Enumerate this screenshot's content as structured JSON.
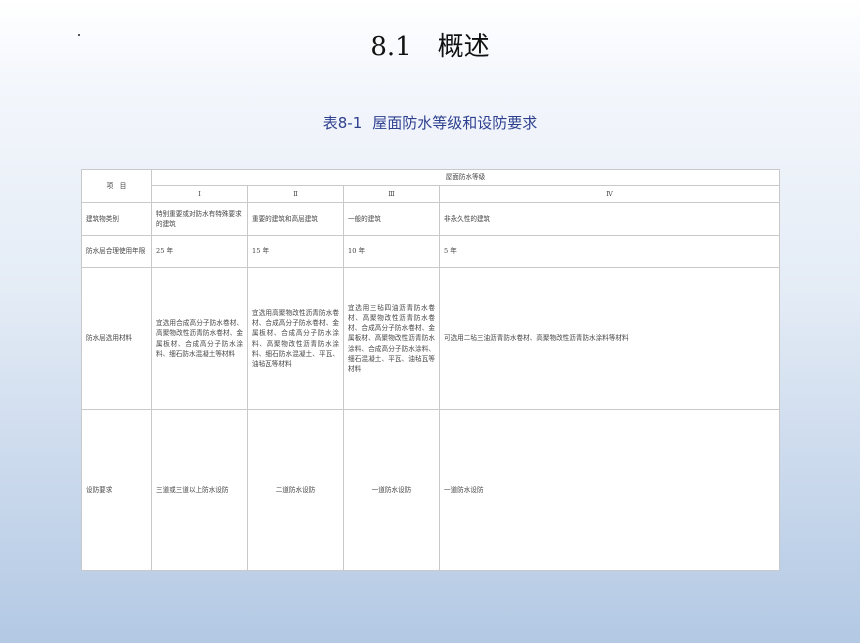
{
  "slide": {
    "section_number": "8.1",
    "section_title": "概述"
  },
  "table_caption": {
    "number": "表8-1",
    "title": "屋面防水等级和设防要求"
  },
  "table": {
    "item_header": "项　目",
    "group_header": "屋面防水等级",
    "levels": [
      "Ⅰ",
      "Ⅱ",
      "Ⅲ",
      "Ⅳ"
    ],
    "rows": [
      {
        "label": "建筑物类别",
        "cells": [
          "特别重要或对防水有特殊要求的建筑",
          "重要的建筑和高层建筑",
          "一般的建筑",
          "非永久性的建筑"
        ]
      },
      {
        "label": "防水层合理使用年限",
        "cells": [
          "25 年",
          "15 年",
          "10 年",
          "5 年"
        ]
      },
      {
        "label": "防水层选用材料",
        "cells": [
          "宜选用合成高分子防水卷材、高聚物改性沥青防水卷材、金属板材、合成高分子防水涂料、细石防水混凝土等材料",
          "宜选用高聚物改性沥青防水卷材、合成高分子防水卷材、金属板材、合成高分子防水涂料、高聚物改性沥青防水涂料、细石防水混凝土、平瓦、油毡瓦等材料",
          "宜选用三毡四油沥青防水卷材、高聚物改性沥青防水卷材、合成高分子防水卷材、金属板材、高聚物改性沥青防水涂料、合成高分子防水涂料、细石混凝土、平瓦、油毡瓦等材料",
          "可选用二毡三油沥青防水卷材、高聚物改性沥青防水涂料等材料"
        ]
      },
      {
        "label": "设防要求",
        "cells": [
          "三道或三道以上防水设防",
          "二道防水设防",
          "一道防水设防",
          "一道防水设防"
        ]
      }
    ]
  }
}
